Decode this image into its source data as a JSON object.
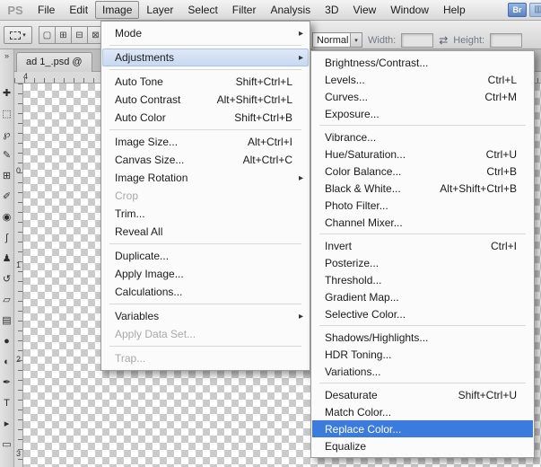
{
  "menubar": {
    "logo": "PS",
    "items": [
      "File",
      "Edit",
      "Image",
      "Layer",
      "Select",
      "Filter",
      "Analysis",
      "3D",
      "View",
      "Window",
      "Help"
    ],
    "active_item": "Image",
    "bridge_button_label": "Br"
  },
  "options_bar": {
    "style_value": "Normal",
    "dropdown_arrow": "▾",
    "width_label": "Width:",
    "width_value": "",
    "swap_icon": "⇄",
    "height_label": "Height:",
    "height_value": "",
    "mode_buttons": [
      {
        "name": "new-selection-button",
        "glyph": "▢"
      },
      {
        "name": "add-to-selection-button",
        "glyph": "⊞"
      },
      {
        "name": "subtract-from-selection-button",
        "glyph": "⊟"
      },
      {
        "name": "intersect-selection-button",
        "glyph": "⊠"
      }
    ]
  },
  "tools_panel": {
    "collapse_glyph": "»",
    "tools": [
      {
        "name": "move-tool",
        "glyph": "✚"
      },
      {
        "name": "rectangular-marquee-tool",
        "glyph": "⬚"
      },
      {
        "name": "lasso-tool",
        "glyph": "℘"
      },
      {
        "name": "quick-selection-tool",
        "glyph": "✎"
      },
      {
        "name": "crop-tool",
        "glyph": "⊞"
      },
      {
        "name": "eyedropper-tool",
        "glyph": "✐"
      },
      {
        "name": "spot-healing-brush-tool",
        "glyph": "◉"
      },
      {
        "name": "brush-tool",
        "glyph": "ʃ"
      },
      {
        "name": "clone-stamp-tool",
        "glyph": "♟"
      },
      {
        "name": "history-brush-tool",
        "glyph": "↺"
      },
      {
        "name": "eraser-tool",
        "glyph": "▱"
      },
      {
        "name": "gradient-tool",
        "glyph": "▤"
      },
      {
        "name": "blur-tool",
        "glyph": "●"
      },
      {
        "name": "dodge-tool",
        "glyph": "◐"
      },
      {
        "name": "pen-tool",
        "glyph": "✒"
      },
      {
        "name": "type-tool",
        "glyph": "T"
      },
      {
        "name": "path-selection-tool",
        "glyph": "▸"
      },
      {
        "name": "rectangle-tool",
        "glyph": "▭"
      }
    ]
  },
  "document": {
    "tab_title": "ad 1_.psd @",
    "h_ruler_label": "4",
    "v_ruler_labels": [
      "0",
      "1",
      "2",
      "3"
    ]
  },
  "image_menu": {
    "items": [
      {
        "label": "Mode",
        "submenu": true
      },
      {
        "sep": true
      },
      {
        "label": "Adjustments",
        "submenu": true,
        "highlighted": true
      },
      {
        "sep": true
      },
      {
        "label": "Auto Tone",
        "shortcut": "Shift+Ctrl+L"
      },
      {
        "label": "Auto Contrast",
        "shortcut": "Alt+Shift+Ctrl+L"
      },
      {
        "label": "Auto Color",
        "shortcut": "Shift+Ctrl+B"
      },
      {
        "sep": true
      },
      {
        "label": "Image Size...",
        "shortcut": "Alt+Ctrl+I"
      },
      {
        "label": "Canvas Size...",
        "shortcut": "Alt+Ctrl+C"
      },
      {
        "label": "Image Rotation",
        "submenu": true
      },
      {
        "label": "Crop",
        "disabled": true
      },
      {
        "label": "Trim..."
      },
      {
        "label": "Reveal All"
      },
      {
        "sep": true
      },
      {
        "label": "Duplicate..."
      },
      {
        "label": "Apply Image..."
      },
      {
        "label": "Calculations..."
      },
      {
        "sep": true
      },
      {
        "label": "Variables",
        "submenu": true
      },
      {
        "label": "Apply Data Set...",
        "disabled": true
      },
      {
        "sep": true
      },
      {
        "label": "Trap...",
        "disabled": true
      }
    ]
  },
  "adjustments_submenu": {
    "items": [
      {
        "label": "Brightness/Contrast..."
      },
      {
        "label": "Levels...",
        "shortcut": "Ctrl+L"
      },
      {
        "label": "Curves...",
        "shortcut": "Ctrl+M"
      },
      {
        "label": "Exposure..."
      },
      {
        "sep": true
      },
      {
        "label": "Vibrance..."
      },
      {
        "label": "Hue/Saturation...",
        "shortcut": "Ctrl+U"
      },
      {
        "label": "Color Balance...",
        "shortcut": "Ctrl+B"
      },
      {
        "label": "Black & White...",
        "shortcut": "Alt+Shift+Ctrl+B"
      },
      {
        "label": "Photo Filter..."
      },
      {
        "label": "Channel Mixer..."
      },
      {
        "sep": true
      },
      {
        "label": "Invert",
        "shortcut": "Ctrl+I"
      },
      {
        "label": "Posterize..."
      },
      {
        "label": "Threshold..."
      },
      {
        "label": "Gradient Map..."
      },
      {
        "label": "Selective Color..."
      },
      {
        "sep": true
      },
      {
        "label": "Shadows/Highlights..."
      },
      {
        "label": "HDR Toning..."
      },
      {
        "label": "Variations..."
      },
      {
        "sep": true
      },
      {
        "label": "Desaturate",
        "shortcut": "Shift+Ctrl+U"
      },
      {
        "label": "Match Color..."
      },
      {
        "label": "Replace Color...",
        "selected": true
      },
      {
        "label": "Equalize"
      }
    ]
  },
  "colors": {
    "selection_blue": "#3b7bdd",
    "highlight_blue": "#dfe8f6"
  }
}
